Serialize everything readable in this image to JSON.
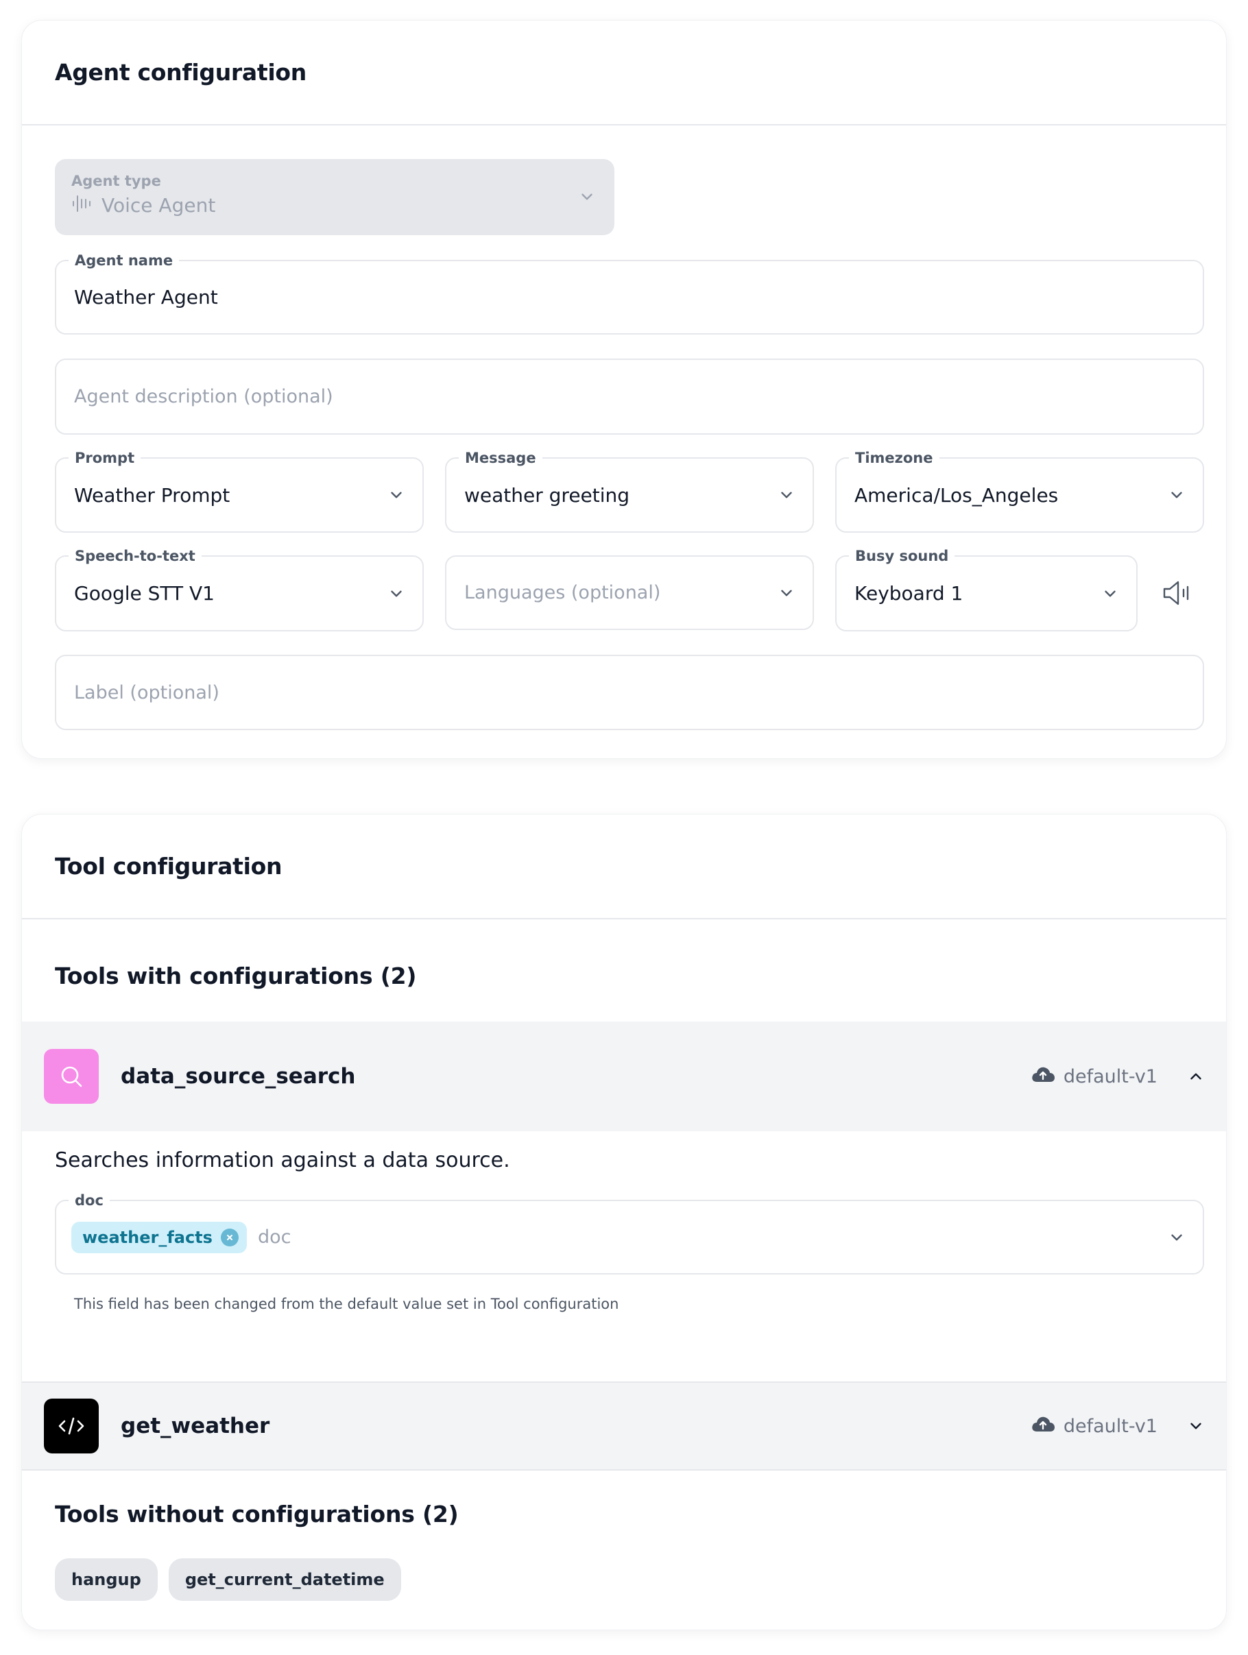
{
  "agent_config": {
    "title": "Agent configuration",
    "agent_type": {
      "label": "Agent type",
      "value": "Voice Agent",
      "icon": "waveform-icon"
    },
    "agent_name": {
      "label": "Agent name",
      "value": "Weather Agent"
    },
    "agent_description": {
      "placeholder": "Agent description (optional)"
    },
    "prompt": {
      "label": "Prompt",
      "value": "Weather Prompt"
    },
    "message": {
      "label": "Message",
      "value": "weather greeting"
    },
    "timezone": {
      "label": "Timezone",
      "value": "America/Los_Angeles"
    },
    "speech_to_text": {
      "label": "Speech-to-text",
      "value": "Google STT V1"
    },
    "languages": {
      "placeholder": "Languages (optional)"
    },
    "busy_sound": {
      "label": "Busy sound",
      "value": "Keyboard 1"
    },
    "label_field": {
      "placeholder": "Label (optional)"
    }
  },
  "tool_config": {
    "title": "Tool configuration",
    "with_config_title": "Tools with configurations (2)",
    "tools": [
      {
        "name": "data_source_search",
        "version": "default-v1",
        "icon": "search-icon",
        "icon_color": "#f78be8",
        "expanded": true,
        "description": "Searches information against a data source.",
        "doc_field": {
          "label": "doc",
          "chip": "weather_facts",
          "placeholder": "doc",
          "helper": "This field has been changed from the default value set in Tool configuration"
        }
      },
      {
        "name": "get_weather",
        "version": "default-v1",
        "icon": "code-icon",
        "icon_color": "#000000",
        "expanded": false
      }
    ],
    "without_config_title": "Tools without configurations (2)",
    "tools_without_config": [
      "hangup",
      "get_current_datetime"
    ]
  }
}
